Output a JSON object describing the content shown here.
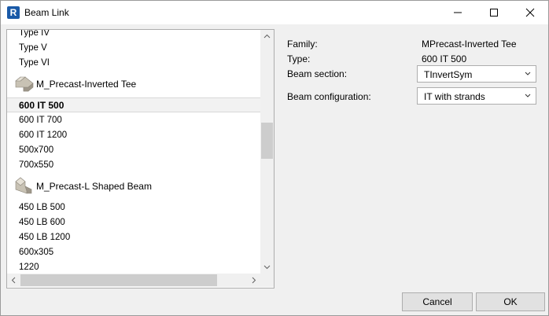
{
  "window": {
    "title": "Beam Link",
    "app_icon_letter": "R"
  },
  "list": {
    "top_items": [
      "Type IV",
      "Type V",
      "Type VI"
    ],
    "family1": {
      "label": "M_Precast-Inverted Tee",
      "items": [
        "600 IT 500",
        "600 IT 700",
        "600 IT 1200",
        "500x700",
        "700x550"
      ],
      "selected_index": 0
    },
    "family2": {
      "label": "M_Precast-L Shaped Beam",
      "items": [
        "450 LB 500",
        "450 LB 600",
        "450 LB 1200",
        "600x305",
        "1220"
      ]
    }
  },
  "properties": {
    "family_label": "Family:",
    "family_value": "MPrecast-Inverted Tee",
    "type_label": "Type:",
    "type_value": "600 IT 500",
    "beam_section_label": "Beam section:",
    "beam_section_value": "TInvertSym",
    "beam_config_label": "Beam configuration:",
    "beam_config_value": "IT with strands"
  },
  "buttons": {
    "cancel": "Cancel",
    "ok": "OK"
  }
}
